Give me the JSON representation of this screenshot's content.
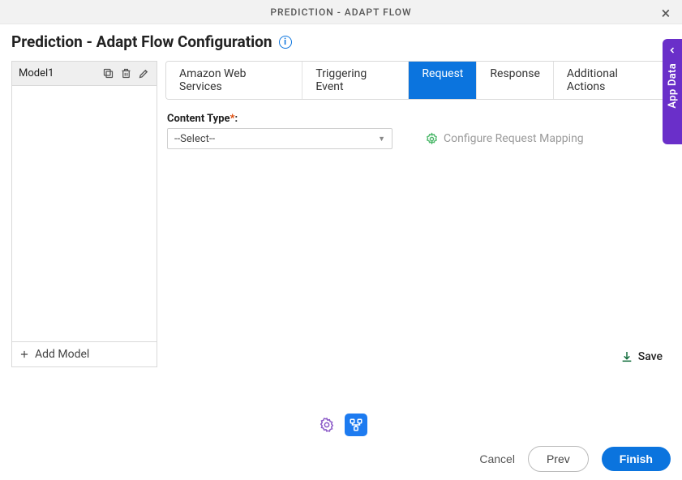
{
  "titlebar": {
    "title": "PREDICTION - ADAPT FLOW"
  },
  "header": {
    "title": "Prediction - Adapt Flow Configuration"
  },
  "sidebar": {
    "model_name": "Model1",
    "add_label": "Add Model"
  },
  "tabs": {
    "aws": "Amazon Web Services",
    "trigger": "Triggering Event",
    "request": "Request",
    "response": "Response",
    "additional": "Additional Actions"
  },
  "form": {
    "content_type_label": "Content Type",
    "select_placeholder": "--Select--",
    "configure_mapping": "Configure Request Mapping"
  },
  "actions": {
    "save": "Save"
  },
  "footer": {
    "cancel": "Cancel",
    "prev": "Prev",
    "finish": "Finish"
  },
  "drawer": {
    "label": "App Data"
  }
}
